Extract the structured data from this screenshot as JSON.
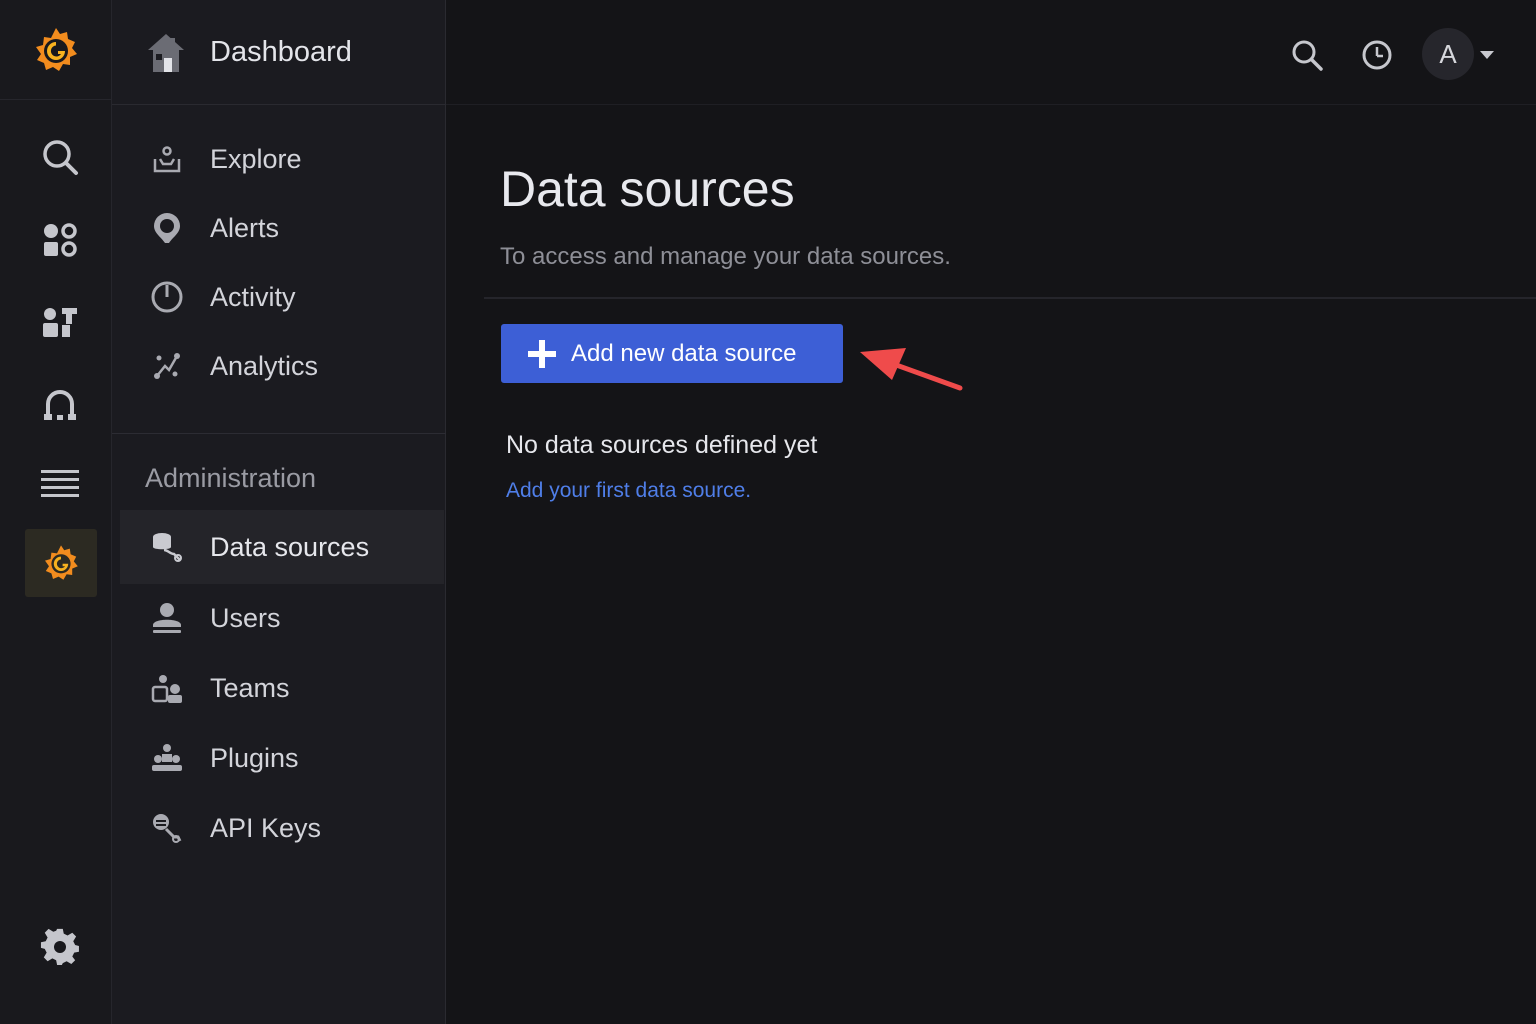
{
  "rail": {
    "icons": [
      "grafana-logo-icon",
      "search-icon",
      "dashboards-icon",
      "create-icon",
      "alerting-icon",
      "menu-icon",
      "grafana-admin-icon",
      "settings-gear-icon"
    ],
    "accent_color": "#f5a623"
  },
  "nav": {
    "header": {
      "title": "Dashboard",
      "icon": "home-icon"
    },
    "items": [
      {
        "label": "Explore",
        "icon": "explore-icon"
      },
      {
        "label": "Alerts",
        "icon": "alert-bell-icon"
      },
      {
        "label": "Activity",
        "icon": "activity-icon"
      },
      {
        "label": "Analytics",
        "icon": "analytics-icon"
      }
    ],
    "section_title": "Administration",
    "admin_items": [
      {
        "label": "Data sources",
        "icon": "database-icon",
        "active": true
      },
      {
        "label": "Users",
        "icon": "user-icon"
      },
      {
        "label": "Teams",
        "icon": "teams-icon"
      },
      {
        "label": "Plugins",
        "icon": "plugin-icon"
      },
      {
        "label": "API Keys",
        "icon": "key-icon"
      }
    ]
  },
  "topbar": {
    "avatar_initial": "A",
    "icons": [
      "search-icon",
      "history-clock-icon"
    ]
  },
  "main": {
    "title": "Data sources",
    "subtitle": "To access and manage your data sources.",
    "add_button_label": "Add new data source",
    "empty_title": "No data sources defined yet",
    "empty_link": "Add your first data source.",
    "button_color": "#3d5fd6",
    "link_color": "#4f7ee8",
    "annotation_arrow_color": "#ef4b4b"
  }
}
